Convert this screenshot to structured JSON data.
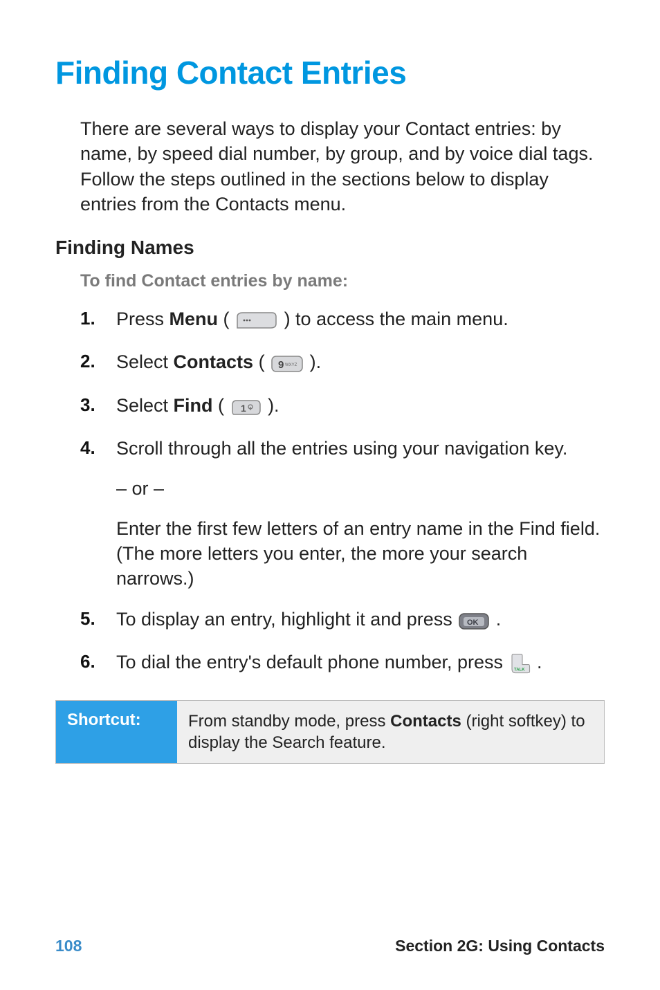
{
  "title": "Finding Contact Entries",
  "intro": "There are several ways to display your Contact entries: by name, by speed dial number, by group, and by voice dial tags. Follow the steps outlined in the sections below to display entries from the Contacts menu.",
  "subhead": "Finding Names",
  "lead": "To find Contact entries by name:",
  "steps": {
    "s1_num": "1.",
    "s1_a": "Press ",
    "s1_b": "Menu",
    "s1_c": " (",
    "s1_d": ") to access the main menu.",
    "s2_num": "2.",
    "s2_a": "Select ",
    "s2_b": "Contacts",
    "s2_c": " (",
    "s2_d": ").",
    "s3_num": "3.",
    "s3_a": "Select ",
    "s3_b": "Find",
    "s3_c": " (",
    "s3_d": ").",
    "s4_num": "4.",
    "s4_text": "Scroll through all the entries using your navigation key.",
    "or": "– or –",
    "s4_para": "Enter the first few letters of an entry name in the Find field. (The more letters you enter, the more your search narrows.)",
    "s5_num": "5.",
    "s5_a": "To display an entry, highlight it and press ",
    "s5_b": ".",
    "s6_num": "6.",
    "s6_a": "To dial the entry's default phone number, press ",
    "s6_b": "."
  },
  "shortcut": {
    "label": "Shortcut:",
    "a": "From standby mode, press ",
    "b": "Contacts",
    "c": " (right softkey) to display the Search feature."
  },
  "footer": {
    "page": "108",
    "section": "Section 2G: Using Contacts"
  }
}
